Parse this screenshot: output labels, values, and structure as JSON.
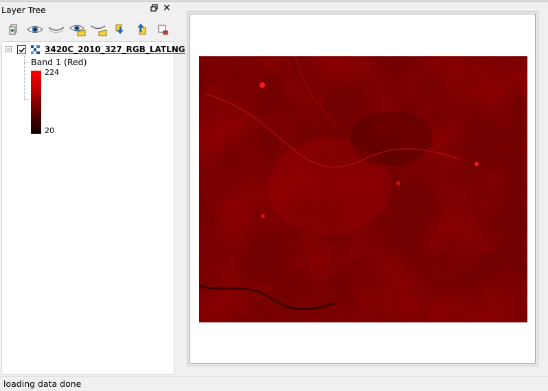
{
  "dock": {
    "title": "Layer Tree",
    "toolbar": [
      {
        "name": "add-layer-icon"
      },
      {
        "name": "show-all-icon"
      },
      {
        "name": "hide-all-icon"
      },
      {
        "name": "show-selected-icon"
      },
      {
        "name": "hide-selected-icon"
      },
      {
        "name": "move-down-icon"
      },
      {
        "name": "move-up-icon"
      },
      {
        "name": "remove-layer-icon"
      }
    ]
  },
  "tree": {
    "layer": {
      "name": "3420C_2010_327_RGB_LATLNG",
      "checked": true,
      "band": {
        "label": "Band 1 (Red)",
        "max": "224",
        "min": "20"
      }
    }
  },
  "status": {
    "text": "loading data done"
  }
}
